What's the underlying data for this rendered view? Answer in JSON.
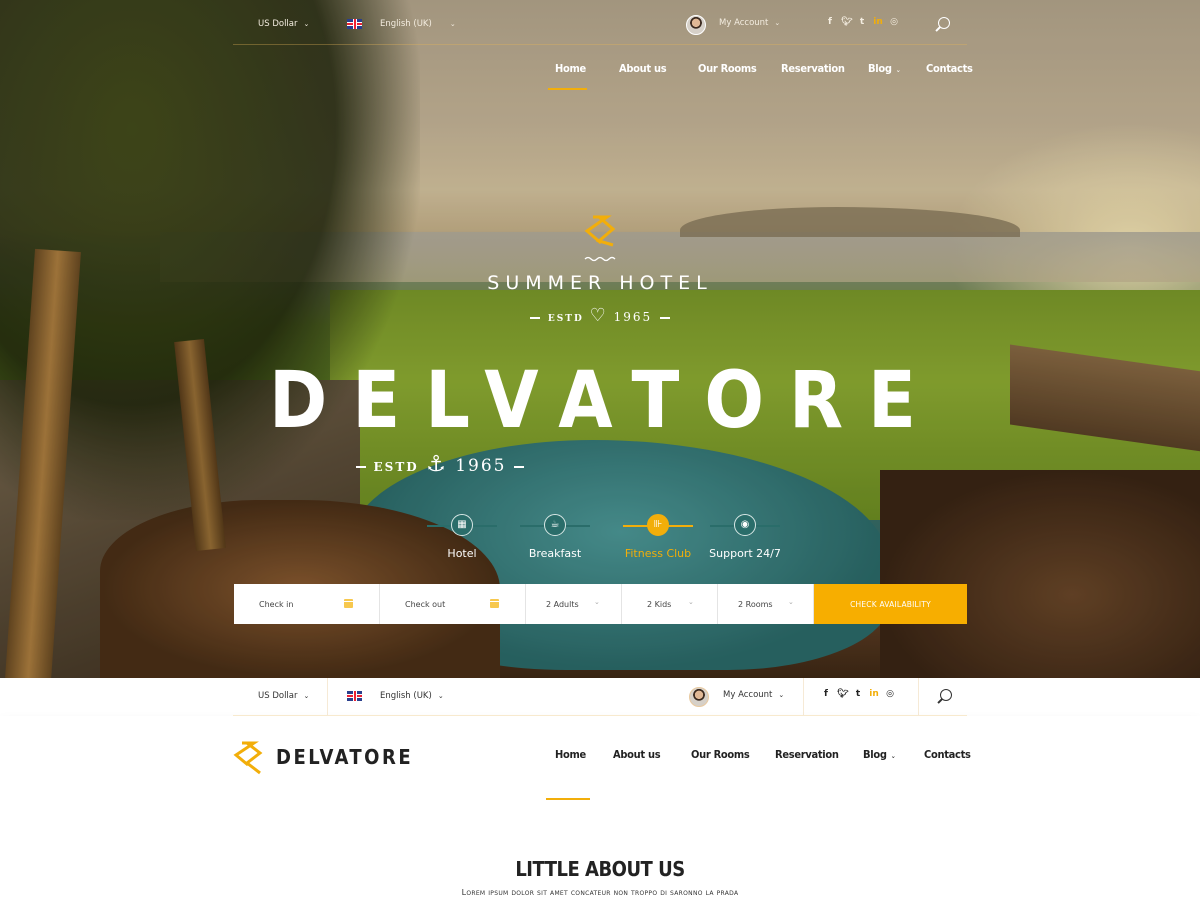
{
  "topbar": {
    "currency": "US Dollar",
    "language": "English (UK)",
    "account": "My Account",
    "social": [
      "f",
      "t",
      "t",
      "in",
      "dribbble"
    ]
  },
  "nav": {
    "items": [
      "Home",
      "About us",
      "Our Rooms",
      "Reservation",
      "Blog",
      "Contacts"
    ],
    "active": "Home"
  },
  "hero": {
    "subtitle": "SUMMER HOTEL",
    "estd_small": "ESTD",
    "year_small": "1965",
    "title": "DELVATORE",
    "estd_big": "ESTD",
    "year_big": "1965"
  },
  "features": [
    {
      "label": "Hotel",
      "icon": "hotel-icon",
      "active": false
    },
    {
      "label": "Breakfast",
      "icon": "coffee-icon",
      "active": false
    },
    {
      "label": "Fitness Club",
      "icon": "dumbbell-icon",
      "active": true
    },
    {
      "label": "Support 24/7",
      "icon": "support-icon",
      "active": false
    }
  ],
  "booking": {
    "check_in": "Check in",
    "check_out": "Check out",
    "adults": "2 Adults",
    "kids": "2 Kids",
    "rooms": "2 Rooms",
    "button": "CHECK AVAILABILITY"
  },
  "header2": {
    "brand": "DELVATORE",
    "currency": "US Dollar",
    "language": "English (UK)",
    "account": "My Account"
  },
  "about": {
    "title": "LITTLE ABOUT US",
    "subtitle": "Lorem ipsum dolor sit amet concateur non troppo di saronno la prada"
  },
  "colors": {
    "accent": "#f7ae00",
    "teal": "#2a6d6a",
    "text_dark": "#222222"
  }
}
